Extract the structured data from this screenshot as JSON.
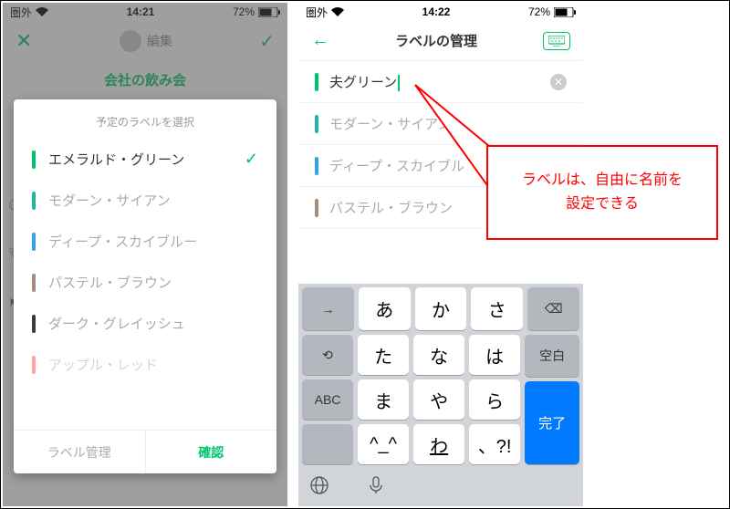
{
  "statusbar": {
    "carrier": "圏外",
    "time_left": "14:21",
    "time_right": "14:22",
    "battery": "72%"
  },
  "left": {
    "edit_label": "編集",
    "event_title": "会社の飲み会",
    "sheet_title": "予定のラベルを選択",
    "labels": [
      {
        "name": "エメラルド・グリーン",
        "color": "#00c468",
        "selected": true
      },
      {
        "name": "モダーン・サイアン",
        "color": "#1fb5a7",
        "selected": false
      },
      {
        "name": "ディープ・スカイブルー",
        "color": "#2aa7f0",
        "selected": false
      },
      {
        "name": "パステル・ブラウン",
        "color": "#a98c77",
        "selected": false
      },
      {
        "name": "ダーク・グレイッシュ",
        "color": "#3b3b3b",
        "selected": false
      },
      {
        "name": "アップル・レッド",
        "color": "#ff4d4d",
        "selected": false
      }
    ],
    "manage_label": "ラベル管理",
    "confirm_label": "確認"
  },
  "right": {
    "header_title": "ラベルの管理",
    "editing_value": "夫グリーン",
    "labels": [
      {
        "name": "モダーン・サイアン",
        "color": "#1fb5a7"
      },
      {
        "name": "ディープ・スカイブル",
        "color": "#2aa7f0"
      },
      {
        "name": "パステル・ブラウン",
        "color": "#a98c77"
      }
    ]
  },
  "keyboard": {
    "rows": [
      [
        "→",
        "あ",
        "か",
        "さ"
      ],
      [
        "⟲",
        "た",
        "な",
        "は",
        "空白"
      ],
      [
        "ABC",
        "ま",
        "や",
        "ら"
      ],
      [
        "",
        "^_^",
        "わ",
        "、?!"
      ]
    ],
    "backspace": "⌫",
    "done": "完了"
  },
  "callout": {
    "text": "ラベルは、自由に名前を\n設定できる"
  },
  "colors": {
    "accent": "#00c468",
    "callout": "#ff0000",
    "done_key": "#007aff"
  }
}
